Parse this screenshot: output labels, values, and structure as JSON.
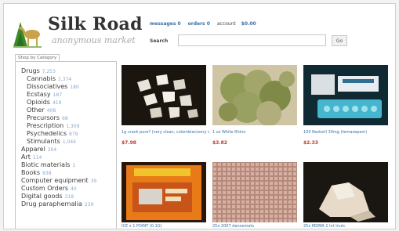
{
  "header": {
    "site_name": "Silk Road",
    "tagline": "anonymous market",
    "nav": {
      "messages": "messages 0",
      "orders": "orders 0",
      "account_label": "account",
      "balance": "$0.00"
    },
    "search_label": "Search",
    "search_value": "",
    "search_button": "Go"
  },
  "sidebar": {
    "tab_label": "Shop by Category",
    "categories": [
      {
        "label": "Drugs",
        "count": "7,253"
      },
      {
        "label": "Cannabis",
        "count": "1,374"
      },
      {
        "label": "Dissociatives",
        "count": "180"
      },
      {
        "label": "Ecstasy",
        "count": "187"
      },
      {
        "label": "Opioids",
        "count": "419"
      },
      {
        "label": "Other",
        "count": "408"
      },
      {
        "label": "Precursors",
        "count": "68"
      },
      {
        "label": "Prescription",
        "count": "1,309"
      },
      {
        "label": "Psychedelics",
        "count": "879"
      },
      {
        "label": "Stimulants",
        "count": "1,044"
      },
      {
        "label": "Apparel",
        "count": "204"
      },
      {
        "label": "Art",
        "count": "114"
      },
      {
        "label": "Biotic materials",
        "count": "1"
      },
      {
        "label": "Books",
        "count": "938"
      },
      {
        "label": "Computer equipment",
        "count": "39"
      },
      {
        "label": "Custom Orders",
        "count": "40"
      },
      {
        "label": "Digital goods",
        "count": "318"
      },
      {
        "label": "Drug paraphernalia",
        "count": "239"
      }
    ]
  },
  "listings": [
    {
      "title": "1g crack pure? (very clean, colombian/very strong",
      "price": "$7.98"
    },
    {
      "title": "1 oz White Rhino",
      "price": "$3.82"
    },
    {
      "title": "100 Restoril 30mg (temazepam)",
      "price": "$2.33"
    },
    {
      "title": "ICE x 1 POINT (0.1G)",
      "price": ""
    },
    {
      "title": "25x 2007 dancemats",
      "price": ""
    },
    {
      "title": "25x MDMA 1 lnt lnutc",
      "price": ""
    }
  ],
  "colors": {
    "link": "#3a6ea5",
    "price": "#c0392b",
    "logo_green": "#2f7d22",
    "logo_camel": "#c9a24a"
  },
  "icons": [
    "camel-logo-icon"
  ]
}
